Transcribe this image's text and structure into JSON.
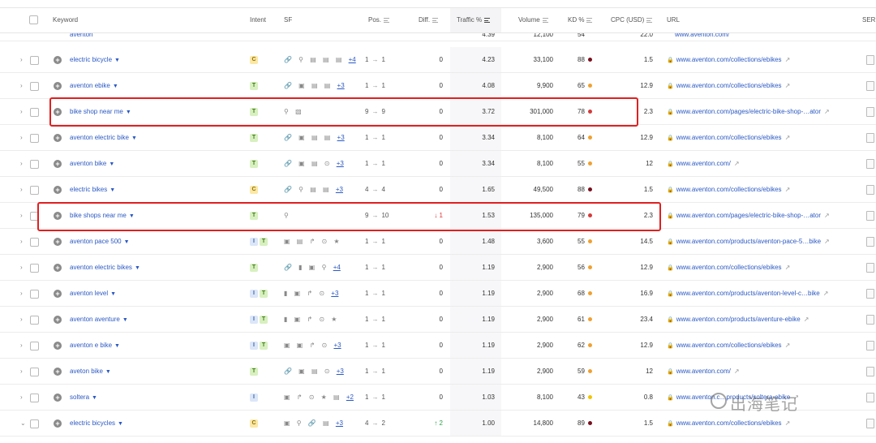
{
  "header": {
    "keyword": "Keyword",
    "intent": "Intent",
    "sf": "SF",
    "pos": "Pos.",
    "diff": "Diff.",
    "traffic": "Traffic %",
    "volume": "Volume",
    "kd": "KD %",
    "cpc": "CPC (USD)",
    "url": "URL",
    "serp": "SERP"
  },
  "partial_row": {
    "keyword": "aventon",
    "traffic": "4.39",
    "volume": "12,100",
    "kd": "54",
    "cpc": "22.0",
    "url": "www.aventon.com/"
  },
  "rows": [
    {
      "keyword": "electric bicycle",
      "intent": [
        "C"
      ],
      "sf": "🔗 ⚲ ▤ ▤ ▤",
      "sf_more": "+4",
      "pos_from": "1",
      "pos_to": "1",
      "diff": "0",
      "traffic": "4.23",
      "volume": "33,100",
      "kd": "88",
      "kd_color": "#7a0f1e",
      "cpc": "1.5",
      "url": "www.aventon.com/collections/ebikes"
    },
    {
      "keyword": "aventon ebike",
      "intent": [
        "T"
      ],
      "sf": "🔗 ▣ ▤ ▤",
      "sf_more": "+3",
      "pos_from": "1",
      "pos_to": "1",
      "diff": "0",
      "traffic": "4.08",
      "volume": "9,900",
      "kd": "65",
      "kd_color": "#f0a030",
      "cpc": "12.9",
      "url": "www.aventon.com/collections/ebikes"
    },
    {
      "keyword": "bike shop near me",
      "intent": [
        "T"
      ],
      "sf": "⚲ ▧",
      "sf_more": "",
      "pos_from": "9",
      "pos_to": "9",
      "diff": "0",
      "traffic": "3.72",
      "volume": "301,000",
      "kd": "78",
      "kd_color": "#d63a3a",
      "cpc": "2.3",
      "url": "www.aventon.com/pages/electric-bike-shop-…ator"
    },
    {
      "keyword": "aventon electric bike",
      "intent": [
        "T"
      ],
      "sf": "🔗 ▣ ▤ ▤",
      "sf_more": "+3",
      "pos_from": "1",
      "pos_to": "1",
      "diff": "0",
      "traffic": "3.34",
      "volume": "8,100",
      "kd": "64",
      "kd_color": "#f0a030",
      "cpc": "12.9",
      "url": "www.aventon.com/collections/ebikes"
    },
    {
      "keyword": "aventon bike",
      "intent": [
        "T"
      ],
      "sf": "🔗 ▣ ▤ ⊙",
      "sf_more": "+3",
      "pos_from": "1",
      "pos_to": "1",
      "diff": "0",
      "traffic": "3.34",
      "volume": "8,100",
      "kd": "55",
      "kd_color": "#f0a030",
      "cpc": "12",
      "url": "www.aventon.com/"
    },
    {
      "keyword": "electric bikes",
      "intent": [
        "C"
      ],
      "sf": "🔗 ⚲ ▤ ▤",
      "sf_more": "+3",
      "pos_from": "4",
      "pos_to": "4",
      "diff": "0",
      "traffic": "1.65",
      "volume": "49,500",
      "kd": "88",
      "kd_color": "#7a0f1e",
      "cpc": "1.5",
      "url": "www.aventon.com/collections/ebikes"
    },
    {
      "keyword": "bike shops near me",
      "intent": [
        "T"
      ],
      "sf": "⚲",
      "sf_more": "",
      "pos_from": "9",
      "pos_to": "10",
      "diff": "1",
      "diff_dir": "down",
      "traffic": "1.53",
      "volume": "135,000",
      "kd": "79",
      "kd_color": "#d63a3a",
      "cpc": "2.3",
      "url": "www.aventon.com/pages/electric-bike-shop-…ator"
    },
    {
      "keyword": "aventon pace 500",
      "intent": [
        "I",
        "T"
      ],
      "sf": "▣ ▤ ↱ ⊙ ★",
      "sf_more": "",
      "pos_from": "1",
      "pos_to": "1",
      "diff": "0",
      "traffic": "1.48",
      "volume": "3,600",
      "kd": "55",
      "kd_color": "#f0a030",
      "cpc": "14.5",
      "url": "www.aventon.com/products/aventon-pace-5…bike"
    },
    {
      "keyword": "aventon electric bikes",
      "intent": [
        "T"
      ],
      "sf": "🔗 ▮ ▣ ⚲",
      "sf_more": "+4",
      "pos_from": "1",
      "pos_to": "1",
      "diff": "0",
      "traffic": "1.19",
      "volume": "2,900",
      "kd": "56",
      "kd_color": "#f0a030",
      "cpc": "12.9",
      "url": "www.aventon.com/collections/ebikes"
    },
    {
      "keyword": "aventon level",
      "intent": [
        "I",
        "T"
      ],
      "sf": "▮ ▣ ↱ ⊙",
      "sf_more": "+3",
      "pos_from": "1",
      "pos_to": "1",
      "diff": "0",
      "traffic": "1.19",
      "volume": "2,900",
      "kd": "68",
      "kd_color": "#f0a030",
      "cpc": "16.9",
      "url": "www.aventon.com/products/aventon-level-c…bike"
    },
    {
      "keyword": "aventon aventure",
      "intent": [
        "I",
        "T"
      ],
      "sf": "▮ ▣ ↱ ⊙ ★",
      "sf_more": "",
      "pos_from": "1",
      "pos_to": "1",
      "diff": "0",
      "traffic": "1.19",
      "volume": "2,900",
      "kd": "61",
      "kd_color": "#f0a030",
      "cpc": "23.4",
      "url": "www.aventon.com/products/aventure-ebike"
    },
    {
      "keyword": "aventon e bike",
      "intent": [
        "I",
        "T"
      ],
      "sf": "▣ ▣ ↱ ⊙",
      "sf_more": "+3",
      "pos_from": "1",
      "pos_to": "1",
      "diff": "0",
      "traffic": "1.19",
      "volume": "2,900",
      "kd": "62",
      "kd_color": "#f0a030",
      "cpc": "12.9",
      "url": "www.aventon.com/collections/ebikes"
    },
    {
      "keyword": "aveton bike",
      "intent": [
        "T"
      ],
      "sf": "🔗 ▣ ▤ ⊙",
      "sf_more": "+3",
      "pos_from": "1",
      "pos_to": "1",
      "diff": "0",
      "traffic": "1.19",
      "volume": "2,900",
      "kd": "59",
      "kd_color": "#f0a030",
      "cpc": "12",
      "url": "www.aventon.com/"
    },
    {
      "keyword": "soltera",
      "intent": [
        "I"
      ],
      "sf": "▣ ↱ ⊙ ★ ▤",
      "sf_more": "+2",
      "pos_from": "1",
      "pos_to": "1",
      "diff": "0",
      "traffic": "1.03",
      "volume": "8,100",
      "kd": "43",
      "kd_color": "#f2c300",
      "cpc": "0.8",
      "url": "www.aventon.c…products/soltera-ebike"
    },
    {
      "keyword": "electric bicycles",
      "intent": [
        "C"
      ],
      "sf": "▣ ⚲ 🔗 ▤",
      "sf_more": "+3",
      "pos_from": "4",
      "pos_to": "2",
      "diff": "2",
      "diff_dir": "up",
      "traffic": "1.00",
      "volume": "14,800",
      "kd": "89",
      "kd_color": "#7a0f1e",
      "cpc": "1.5",
      "url": "www.aventon.com/collections/ebikes"
    }
  ],
  "watermark": "出海笔记"
}
